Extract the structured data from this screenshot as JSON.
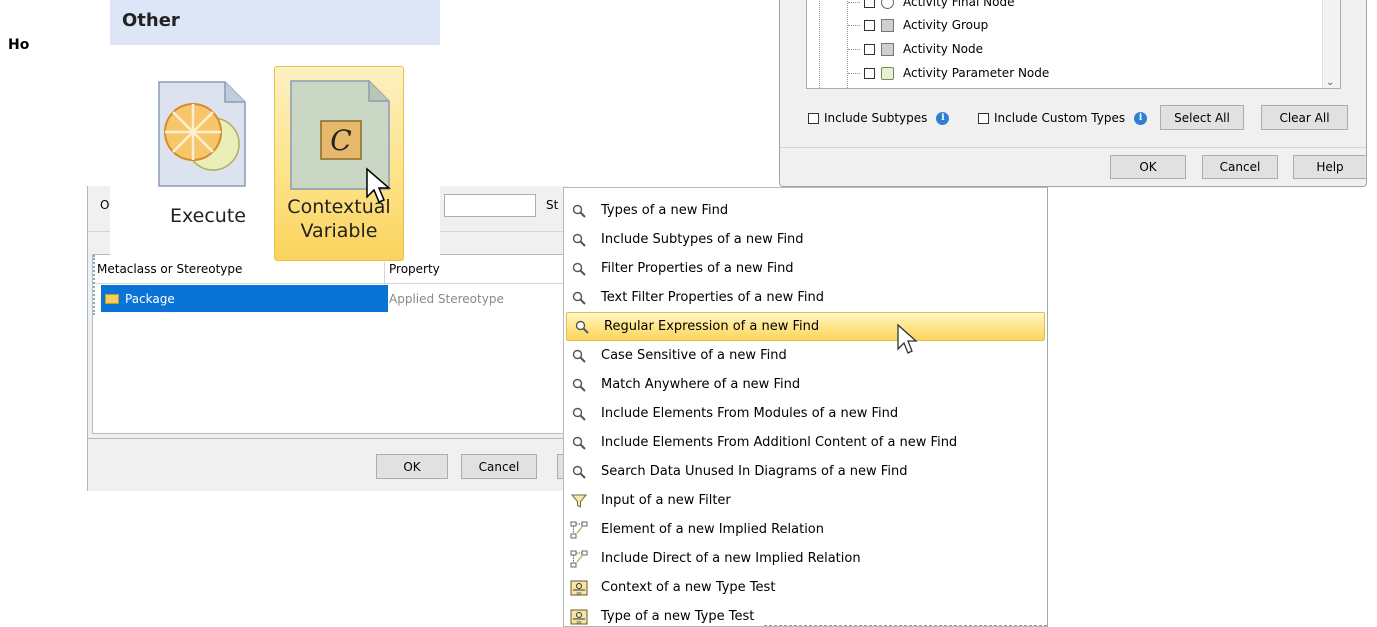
{
  "page": {
    "clipped_heading": "Ho"
  },
  "top_dialog": {
    "tree_items": [
      {
        "label": "Activity Final Node"
      },
      {
        "label": "Activity Group"
      },
      {
        "label": "Activity Node"
      },
      {
        "label": "Activity Parameter Node"
      }
    ],
    "include_subtypes_label": "Include Subtypes",
    "include_custom_types_label": "Include Custom Types",
    "select_all_label": "Select All",
    "clear_all_label": "Clear All",
    "ok_label": "OK",
    "cancel_label": "Cancel",
    "help_label": "Help"
  },
  "ribbon": {
    "group_title": "Other",
    "buttons": [
      {
        "label": "Execute",
        "icon": "execute-icon"
      },
      {
        "label": "Contextual Variable",
        "line1": "Contextual",
        "line2": "Variable",
        "icon": "contextual-variable-icon",
        "glyph": "C"
      }
    ]
  },
  "left_dialog": {
    "clipped_left_label": "O",
    "clipped_right_label": "St",
    "columns": [
      "Metaclass or Stereotype",
      "Property"
    ],
    "rows": [
      {
        "metaclass": "Package",
        "property": "Applied Stereotype"
      }
    ],
    "ok_label": "OK",
    "cancel_label": "Cancel"
  },
  "context_menu": {
    "items": [
      {
        "label": "Types of a new Find",
        "icon": "find-icon"
      },
      {
        "label": "Include Subtypes of a new Find",
        "icon": "find-icon"
      },
      {
        "label": "Filter Properties of a new Find",
        "icon": "find-icon"
      },
      {
        "label": "Text Filter Properties of a new Find",
        "icon": "find-icon"
      },
      {
        "label": "Regular Expression of a new Find",
        "icon": "find-icon",
        "selected": true
      },
      {
        "label": "Case Sensitive of a new Find",
        "icon": "find-icon"
      },
      {
        "label": "Match Anywhere of a new Find",
        "icon": "find-icon"
      },
      {
        "label": "Include Elements From Modules of a new Find",
        "icon": "find-icon"
      },
      {
        "label": "Include Elements From Additionl Content of a new Find",
        "icon": "find-icon"
      },
      {
        "label": "Search Data Unused In Diagrams of a new Find",
        "icon": "find-icon"
      },
      {
        "label": "Input of a new Filter",
        "icon": "filter-icon"
      },
      {
        "label": "Element of a new Implied Relation",
        "icon": "implied-relation-icon"
      },
      {
        "label": "Include Direct of a new Implied Relation",
        "icon": "implied-relation-icon"
      },
      {
        "label": "Context of a new Type Test",
        "icon": "type-test-icon"
      },
      {
        "label": "Type of a new Type Test",
        "icon": "type-test-icon"
      }
    ]
  }
}
